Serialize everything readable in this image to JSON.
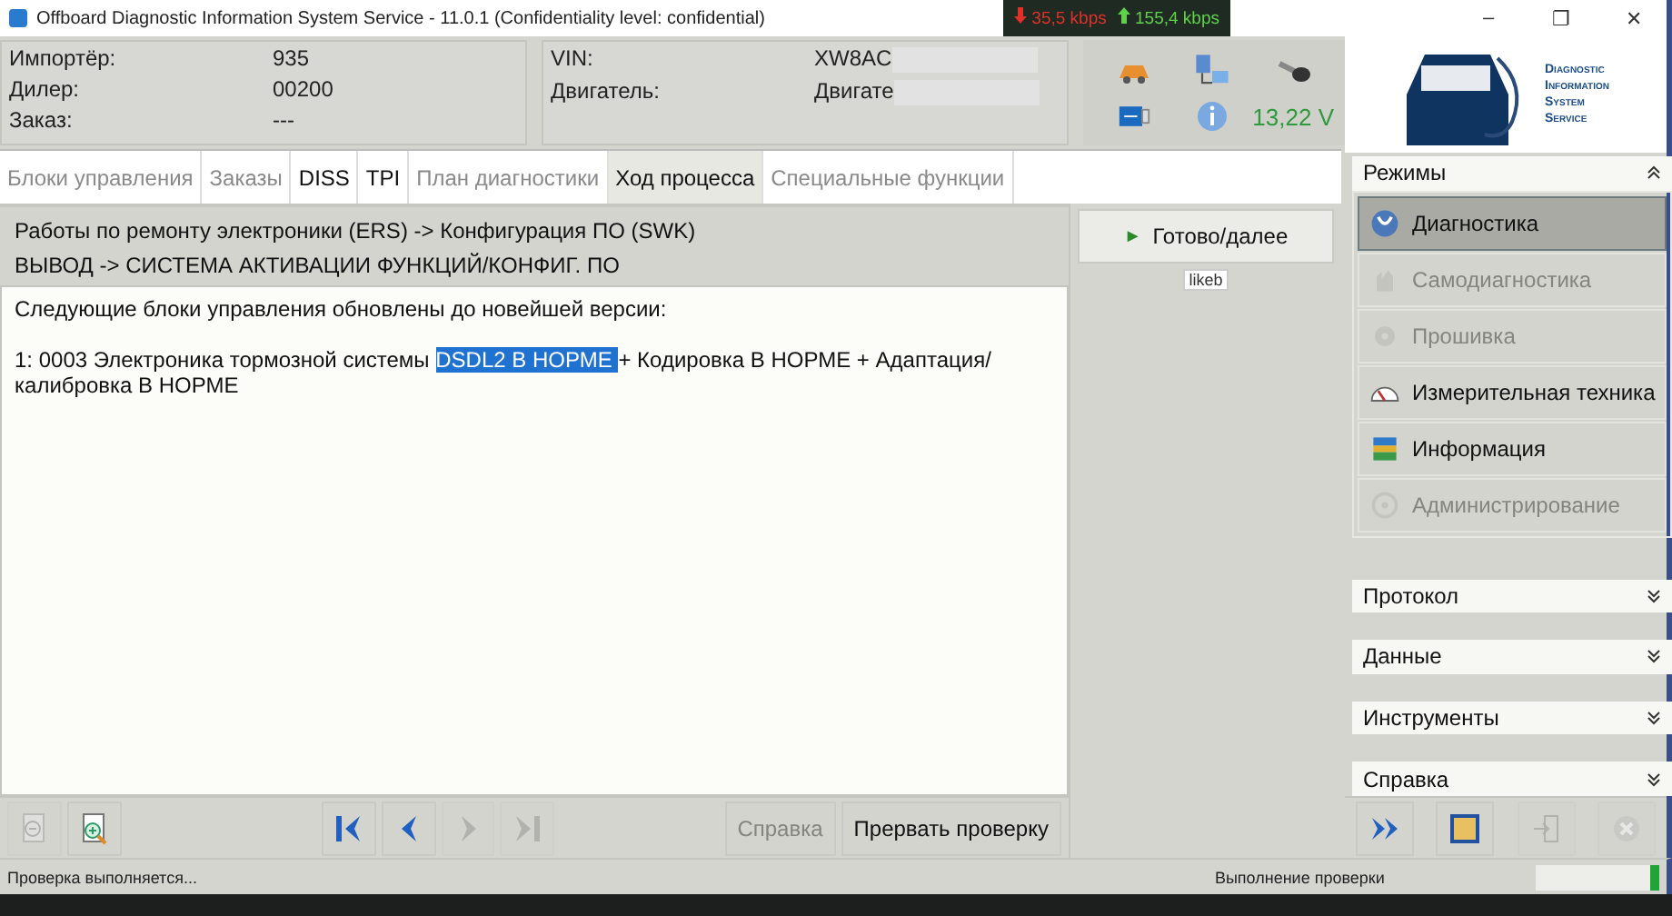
{
  "window": {
    "title": "Offboard Diagnostic Information System Service - 11.0.1 (Confidentiality level: confidential)",
    "minimize": "–",
    "restore": "❐",
    "close": "✕"
  },
  "traffic": [
    {
      "kind": "down",
      "text": "35,5 kbps",
      "color": "#e0302a"
    },
    {
      "kind": "up",
      "text": "155,4 kbps",
      "color": "#5fd14a"
    }
  ],
  "info_left": [
    {
      "label": "Импортёр:",
      "value": "935"
    },
    {
      "label": "Дилер:",
      "value": "00200"
    },
    {
      "label": "Заказ:",
      "value": "---"
    }
  ],
  "info_right": [
    {
      "label": "VIN:",
      "value": "XW8AC"
    },
    {
      "label": "Двигатель:",
      "value": "Двигате"
    }
  ],
  "status_icons": {
    "voltage": "13,22 V"
  },
  "logo": {
    "lines": [
      "Diagnostic",
      "Information",
      "System",
      "Service"
    ]
  },
  "tabs": [
    {
      "label": "Блоки управления",
      "selected": false,
      "disabled": true
    },
    {
      "label": "Заказы",
      "selected": false,
      "disabled": true
    },
    {
      "label": "DISS",
      "selected": false,
      "disabled": false
    },
    {
      "label": "TPI",
      "selected": false,
      "disabled": false
    },
    {
      "label": "План диагностики",
      "selected": false,
      "disabled": true
    },
    {
      "label": "Ход процесса",
      "selected": true,
      "disabled": false
    },
    {
      "label": "Специальные функции",
      "selected": false,
      "disabled": true
    }
  ],
  "breadcrumb": [
    "Работы по ремонту электроники (ERS) -> Конфигурация ПО (SWK)",
    "ВЫВОД -> СИСТЕМА АКТИВАЦИИ ФУНКЦИЙ/КОНФИГ. ПО"
  ],
  "message": {
    "intro": "Следующие блоки управления обновлены до новейшей версии:",
    "before": "1: 0003 Электроника тормозной системы ",
    "highlighted": "DSDL2 В НОРМЕ ",
    "after": "+ Кодировка В НОРМЕ + Адаптация/калибровка В НОРМЕ"
  },
  "next_button": {
    "arrow": "►",
    "label": "Готово/далее",
    "tooltip": "likeb"
  },
  "modes": {
    "title": "Режимы",
    "expanded": true,
    "items": [
      {
        "kind": "diagnosis",
        "label": "Диагностика",
        "selected": true,
        "disabled": false
      },
      {
        "kind": "selftest",
        "label": "Самодиагностика",
        "selected": false,
        "disabled": true
      },
      {
        "kind": "flash",
        "label": "Прошивка",
        "selected": false,
        "disabled": true
      },
      {
        "kind": "measure",
        "label": "Измерительная техника",
        "selected": false,
        "disabled": false
      },
      {
        "kind": "info",
        "label": "Информация",
        "selected": false,
        "disabled": false
      },
      {
        "kind": "admin",
        "label": "Администрирование",
        "selected": false,
        "disabled": true
      }
    ]
  },
  "sections": [
    {
      "label": "Протокол",
      "expanded": false
    },
    {
      "label": "Данные",
      "expanded": false
    },
    {
      "label": "Инструменты",
      "expanded": false
    },
    {
      "label": "Справка",
      "expanded": false
    }
  ],
  "toolbar": {
    "zoom": [
      {
        "kind": "zoom-out",
        "disabled": true
      },
      {
        "kind": "zoom-in",
        "disabled": false
      }
    ],
    "nav": [
      {
        "kind": "first",
        "disabled": false
      },
      {
        "kind": "prev",
        "disabled": false
      },
      {
        "kind": "next",
        "disabled": true
      },
      {
        "kind": "last",
        "disabled": true
      }
    ],
    "buttons": [
      {
        "label": "Справка",
        "disabled": true
      },
      {
        "label": "Прервать проверку",
        "disabled": false
      }
    ]
  },
  "side_toolbar": [
    {
      "kind": "forward",
      "disabled": false
    },
    {
      "kind": "frame",
      "disabled": false
    },
    {
      "kind": "exit",
      "disabled": true
    },
    {
      "kind": "cancel",
      "disabled": true
    }
  ],
  "status_bar": {
    "left": "Проверка выполняется...",
    "right": "Выполнение проверки",
    "level": 0.08
  }
}
